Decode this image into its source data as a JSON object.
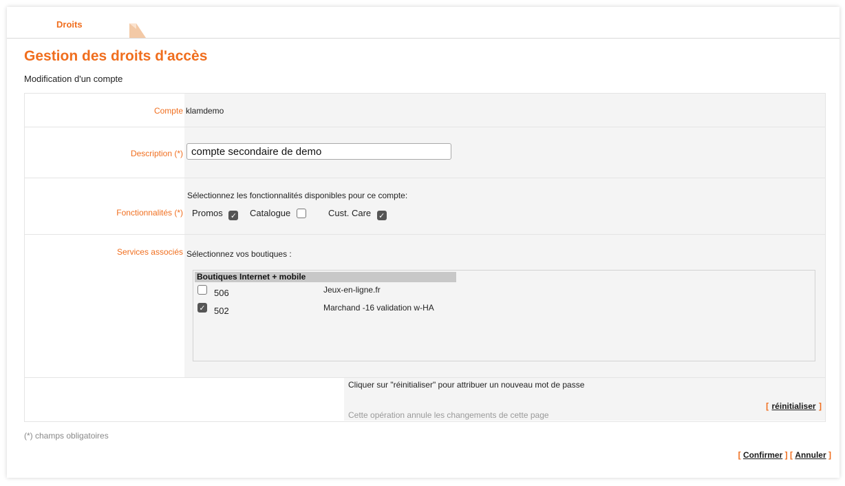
{
  "tabs": [
    {
      "label": "Droits"
    }
  ],
  "page": {
    "title": "Gestion des droits d'accès",
    "subtitle": "Modification d'un compte"
  },
  "form": {
    "account": {
      "label": "Compte",
      "value": "klamdemo"
    },
    "description": {
      "label": "Description (*)",
      "value": "compte secondaire de demo"
    },
    "features": {
      "label": "Fonctionnalités (*)",
      "prompt": "Sélectionnez les fonctionnalités disponibles pour ce compte:",
      "options": [
        {
          "label": "Promos",
          "checked": true
        },
        {
          "label": "Catalogue",
          "checked": false
        },
        {
          "label": "Cust. Care",
          "checked": true
        }
      ]
    },
    "services": {
      "label": "Services associés",
      "prompt": "Sélectionnez vos boutiques :",
      "group_header": "Boutiques Internet + mobile",
      "shops": [
        {
          "id": "506",
          "name": "Jeux-en-ligne.fr",
          "checked": false
        },
        {
          "id": "502",
          "name": "Marchand -16 validation w-HA",
          "checked": true
        }
      ]
    },
    "reset": {
      "info": "Cliquer sur \"réinitialiser\" pour attribuer un nouveau mot de passe",
      "link": "réinitialiser",
      "warning": "Cette opération annule les changements de cette page"
    }
  },
  "footer": {
    "required_note": "(*) champs obligatoires",
    "confirm": "Confirmer",
    "cancel": "Annuler"
  },
  "brackets": {
    "open": "[",
    "close": "]"
  },
  "colors": {
    "accent": "#f06e1e",
    "panel": "#f4f4f4",
    "border": "#e4e4e4"
  }
}
